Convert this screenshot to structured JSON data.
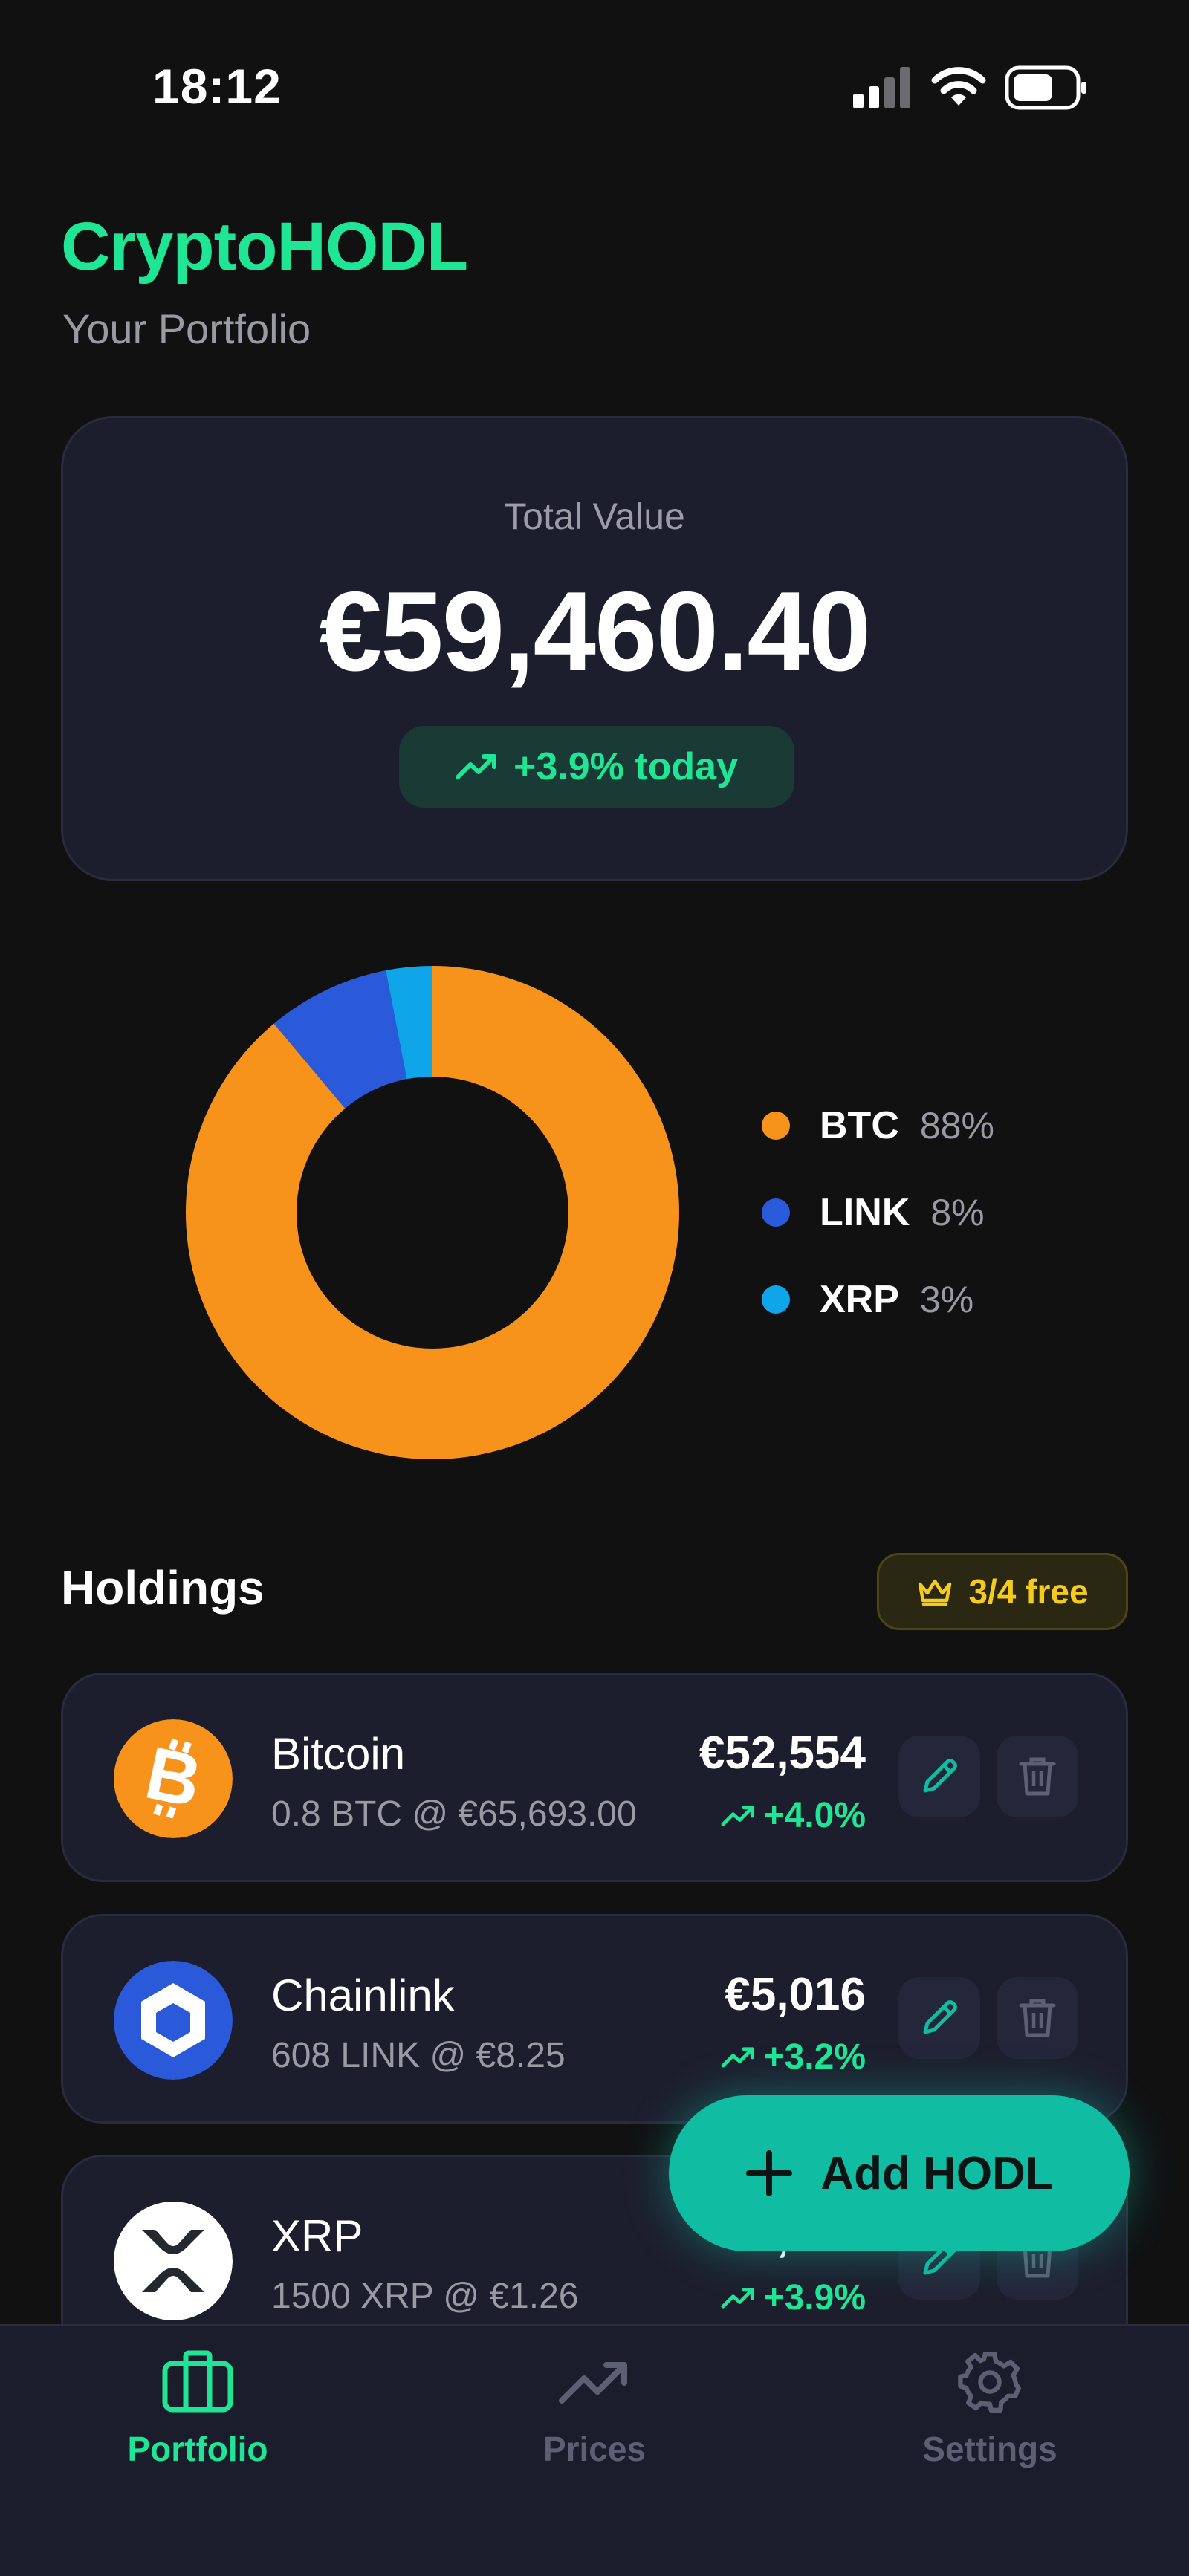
{
  "status_bar": {
    "time": "18:12"
  },
  "header": {
    "title": "CryptoHODL",
    "subtitle": "Your Portfolio"
  },
  "total": {
    "label": "Total Value",
    "value": "€59,460.40",
    "change": "+3.9% today"
  },
  "allocation": {
    "chart_data": {
      "type": "pie",
      "categories": [
        "BTC",
        "LINK",
        "XRP"
      ],
      "values": [
        88,
        8,
        3
      ],
      "colors": [
        "#f7931a",
        "#2a5ada",
        "#0ea5e9"
      ]
    },
    "legend": [
      {
        "label": "BTC",
        "pct": "88%",
        "color": "#f7931a"
      },
      {
        "label": "LINK",
        "pct": "8%",
        "color": "#2a5ada"
      },
      {
        "label": "XRP",
        "pct": "3%",
        "color": "#0ea5e9"
      }
    ]
  },
  "holdings": {
    "title": "Holdings",
    "badge": "3/4 free",
    "items": [
      {
        "name": "Bitcoin",
        "detail": "0.8 BTC @ €65,693.00",
        "value": "€52,554",
        "change": "+4.0%",
        "icon": "bitcoin-icon"
      },
      {
        "name": "Chainlink",
        "detail": "608 LINK @ €8.25",
        "value": "€5,016",
        "change": "+3.2%",
        "icon": "chainlink-icon"
      },
      {
        "name": "XRP",
        "detail": "1500 XRP @ €1.26",
        "value": "€1,890",
        "change": "+3.9%",
        "icon": "xrp-icon"
      }
    ]
  },
  "fab": {
    "label": "Add HODL"
  },
  "nav": {
    "items": [
      {
        "label": "Portfolio",
        "icon": "briefcase-icon",
        "active": true
      },
      {
        "label": "Prices",
        "icon": "trend-icon",
        "active": false
      },
      {
        "label": "Settings",
        "icon": "gear-icon",
        "active": false
      }
    ]
  },
  "colors": {
    "accent": "#1fe695",
    "fab": "#10bda3",
    "card": "#1d1e2d",
    "background": "#111112",
    "gold": "#f5cb1d"
  }
}
